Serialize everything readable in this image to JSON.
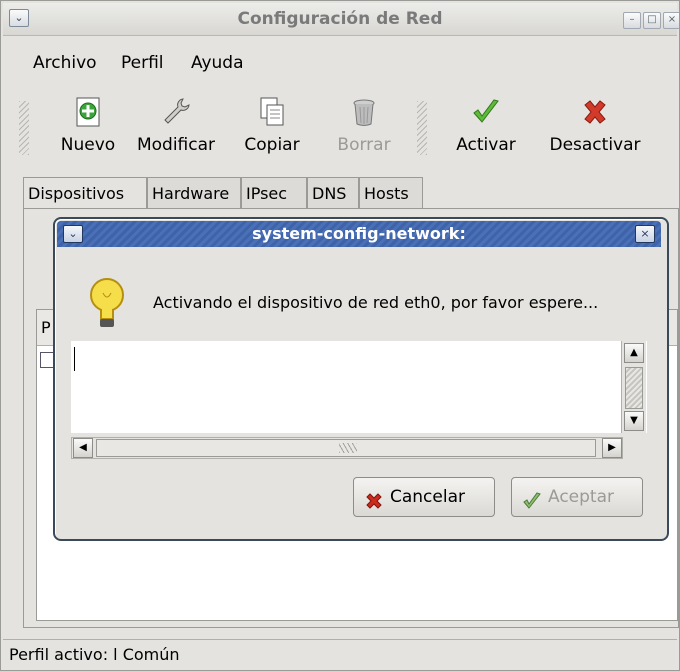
{
  "window": {
    "title": "Configuración de Red",
    "menu_glyph": "⌄",
    "controls": [
      "–",
      "□",
      "×"
    ]
  },
  "menubar": {
    "items": [
      "Archivo",
      "Perfil",
      "Ayuda"
    ]
  },
  "toolbar": {
    "new_label": "Nuevo",
    "edit_label": "Modificar",
    "copy_label": "Copiar",
    "delete_label": "Borrar",
    "activate_label": "Activar",
    "deactivate_label": "Desactivar"
  },
  "tabs": [
    "Dispositivos",
    "Hardware",
    "IPsec",
    "DNS",
    "Hosts"
  ],
  "device_list": {
    "header_partial": "P"
  },
  "statusbar": {
    "text": "Perfil activo: l Común"
  },
  "dialog": {
    "title": "system-config-network:",
    "message": "Activando el dispositivo de red eth0, por favor espere...",
    "cancel_label": "Cancelar",
    "accept_label": "Aceptar"
  },
  "colors": {
    "window_bg": "#e4e3df",
    "dialog_title_bg": "#4569b0",
    "cancel_icon": "#cc2b1d",
    "accept_icon": "#3a9a2a"
  }
}
